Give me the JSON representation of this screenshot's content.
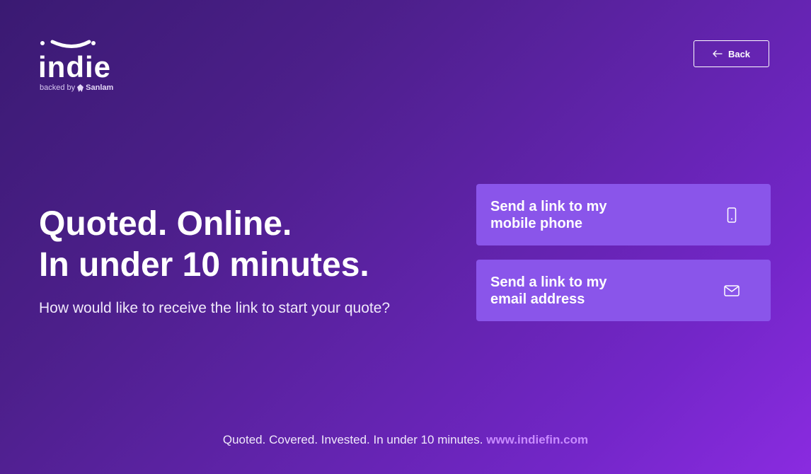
{
  "brand": {
    "logo_text": "indie",
    "tagline_prefix": "backed by",
    "tagline_brand": "Sanlam"
  },
  "header": {
    "back_label": "Back"
  },
  "main": {
    "headline_line1": "Quoted. Online.",
    "headline_line2": "In under 10 minutes.",
    "subtitle": "How would like to receive the link to start your quote?"
  },
  "options": [
    {
      "line1": "Send a link to my",
      "line2": "mobile phone",
      "icon": "mobile-phone-icon"
    },
    {
      "line1": "Send a link to my",
      "line2": "email address",
      "icon": "envelope-icon"
    }
  ],
  "footer": {
    "text": "Quoted. Covered. Invested. In under 10 minutes.",
    "link": "www.indiefin.com"
  },
  "colors": {
    "background_start": "#3a1a72",
    "background_end": "#8a2be0",
    "card": "#8a55ea",
    "link": "#c88bff",
    "text": "#ffffff"
  }
}
